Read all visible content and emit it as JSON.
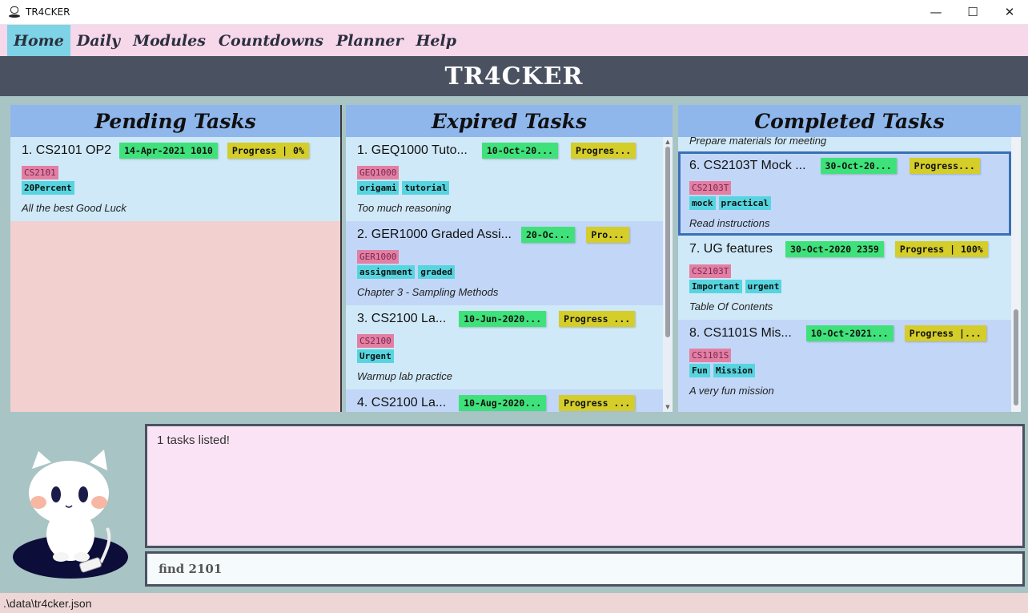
{
  "window": {
    "title": "TR4CKER",
    "minimize": "—",
    "maximize": "☐",
    "close": "✕"
  },
  "menu": {
    "items": [
      "Home",
      "Daily",
      "Modules",
      "Countdowns",
      "Planner",
      "Help"
    ],
    "active": "Home"
  },
  "header": {
    "title": "TR4CKER"
  },
  "pending": {
    "title": "Pending Tasks",
    "tasks": [
      {
        "title": "1.  CS2101 OP2",
        "date": "14-Apr-2021 1010",
        "progress": "Progress | 0%",
        "module": "CS2101",
        "tags": [
          "20Percent"
        ],
        "desc": "All the best Good Luck"
      }
    ]
  },
  "expired": {
    "title": "Expired Tasks",
    "tasks": [
      {
        "title": "1.  GEQ1000 Tuto...",
        "date": "10-Oct-20...",
        "progress": "Progres...",
        "module": "GEQ1000",
        "tags": [
          "origami",
          "tutorial"
        ],
        "desc": "Too much reasoning"
      },
      {
        "title": "2.  GER1000 Graded Assi...",
        "date": "20-Oc...",
        "progress": "Pro...",
        "module": "GER1000",
        "tags": [
          "assignment",
          "graded"
        ],
        "desc": "Chapter 3 - Sampling Methods"
      },
      {
        "title": "3.  CS2100 La...",
        "date": "10-Jun-2020...",
        "progress": "Progress ...",
        "module": "CS2100",
        "tags": [
          "Urgent"
        ],
        "desc": "Warmup lab practice"
      },
      {
        "title": "4.  CS2100 La...",
        "date": "10-Aug-2020...",
        "progress": "Progress ...",
        "module": "",
        "tags": [],
        "desc": ""
      }
    ]
  },
  "completed": {
    "title": "Completed Tasks",
    "partial_desc": "Prepare materials for meeting",
    "tasks": [
      {
        "title": "6.  CS2103T Mock ...",
        "date": "30-Oct-20...",
        "progress": "Progress...",
        "module": "CS2103T",
        "tags": [
          "mock",
          "practical"
        ],
        "desc": "Read instructions"
      },
      {
        "title": "7.  UG features",
        "date": "30-Oct-2020 2359",
        "progress": "Progress | 100%",
        "module": "CS2103T",
        "tags": [
          "Important",
          "urgent"
        ],
        "desc": "Table Of Contents"
      },
      {
        "title": "8.  CS1101S Mis...",
        "date": "10-Oct-2021...",
        "progress": "Progress |...",
        "module": "CS1101S",
        "tags": [
          "Fun",
          "Mission"
        ],
        "desc": "A very fun mission"
      }
    ]
  },
  "result": {
    "text": "1 tasks listed!"
  },
  "command": {
    "value": "find 2101"
  },
  "status": {
    "path": ".\\data\\tr4cker.json"
  },
  "colors": {
    "menu_bg": "#f7d7ea",
    "header_bg": "#4a5262",
    "panel_header": "#8fb7ec",
    "date_tag": "#3fe27a",
    "progress_tag": "#d4cd2a",
    "module_tag": "#e27fa3",
    "keyword_tag": "#56d5e0"
  }
}
